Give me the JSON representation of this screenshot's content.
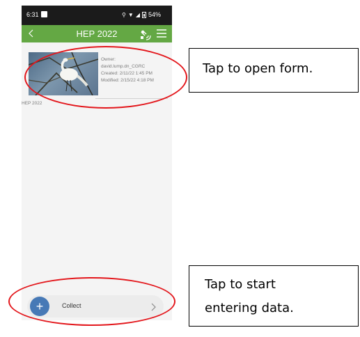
{
  "status_bar": {
    "time": "6:31",
    "battery": "54%"
  },
  "app_bar": {
    "title": "HEP 2022",
    "back_icon": "chevron-left-icon",
    "gps_icon": "satellite-gps-icon",
    "menu_icon": "hamburger-menu-icon"
  },
  "form": {
    "thumbnail": "egret-photo",
    "owner_label": "Owner:",
    "owner": "david.lump.dn_CGRC",
    "created": "Created: 2/11/22 1:45 PM",
    "modified": "Modified: 2/15/22 4:18 PM"
  },
  "project_label": "HEP 2022",
  "collect": {
    "label": "Collect",
    "plus": "+"
  },
  "annotations": {
    "open_form": "Tap to open form.",
    "start_line1": "Tap to start",
    "start_line2": "entering data."
  },
  "colors": {
    "app_bar": "#64a844",
    "fab": "#4779b6",
    "annotation_ring": "#e3161b",
    "status_bar": "#1b1b1b"
  }
}
